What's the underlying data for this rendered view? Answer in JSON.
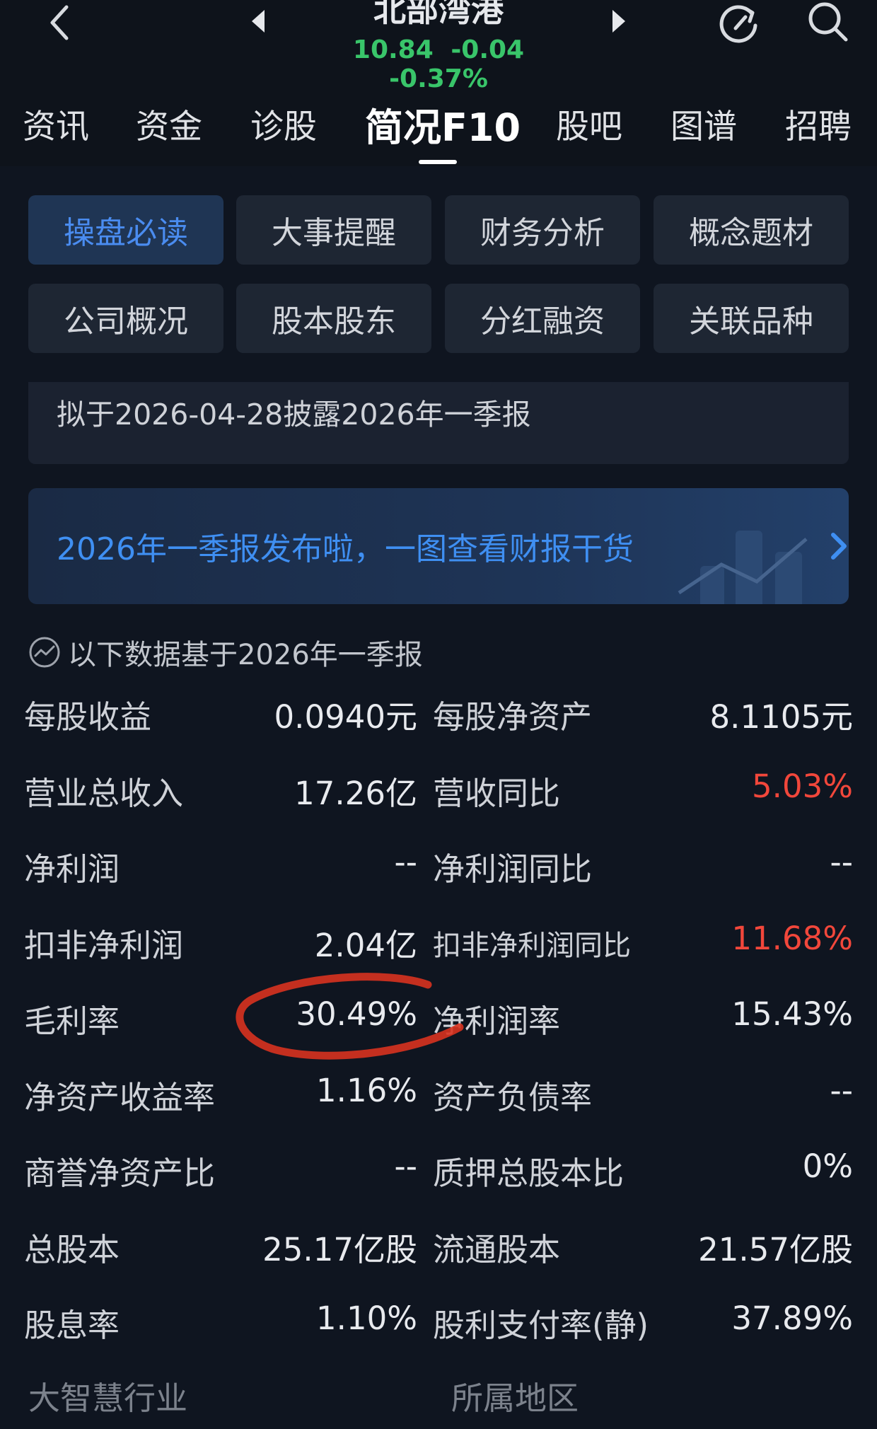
{
  "header": {
    "stock_name": "北部湾港",
    "price": "10.84",
    "change": "-0.04",
    "change_pct": "-0.37%",
    "quote_color": "#39c56a"
  },
  "main_tabs": [
    {
      "label": "资讯"
    },
    {
      "label": "资金"
    },
    {
      "label": "诊股"
    },
    {
      "label": "简况F10",
      "active": true
    },
    {
      "label": "股吧"
    },
    {
      "label": "图谱"
    },
    {
      "label": "招聘"
    }
  ],
  "sub_tabs": [
    {
      "label": "操盘必读",
      "active": true
    },
    {
      "label": "大事提醒"
    },
    {
      "label": "财务分析"
    },
    {
      "label": "概念题材"
    },
    {
      "label": "公司概况"
    },
    {
      "label": "股本股东"
    },
    {
      "label": "分红融资"
    },
    {
      "label": "关联品种"
    }
  ],
  "notice": "拟于2026-04-28披露2026年一季报",
  "banner": {
    "text": "2026年一季报发布啦，一图查看财报干货",
    "color": "#3f8ff2"
  },
  "basis_text": "以下数据基于2026年一季报",
  "metrics": [
    {
      "l1": "每股收益",
      "v1": "0.0940元",
      "l2": "每股净资产",
      "v2": "8.1105元"
    },
    {
      "l1": "营业总收入",
      "v1": "17.26亿",
      "l2": "营收同比",
      "v2": "5.03%"
    },
    {
      "l1": "净利润",
      "v1": "--",
      "l2": "净利润同比",
      "v2": "--"
    },
    {
      "l1": "扣非净利润",
      "v1": "2.04亿",
      "l2": "扣非净利润同比",
      "v2": "11.68%"
    },
    {
      "l1": "毛利率",
      "v1": "30.49%",
      "l2": "净利润率",
      "v2": "15.43%"
    },
    {
      "l1": "净资产收益率",
      "v1": "1.16%",
      "l2": "资产负债率",
      "v2": "--"
    },
    {
      "l1": "商誉净资产比",
      "v1": "--",
      "l2": "质押总股本比",
      "v2": "0%"
    },
    {
      "l1": "总股本",
      "v1": "25.17亿股",
      "l2": "流通股本",
      "v2": "21.57亿股"
    },
    {
      "l1": "股息率",
      "v1": "1.10%",
      "l2": "股利支付率(静)",
      "v2": "37.89%"
    }
  ],
  "footer": {
    "left": "大智慧行业",
    "right": "所属地区"
  },
  "colors": {
    "up_red": "#f2473b",
    "active_blue": "#4a8cf0",
    "annotation": "#d8321f"
  }
}
